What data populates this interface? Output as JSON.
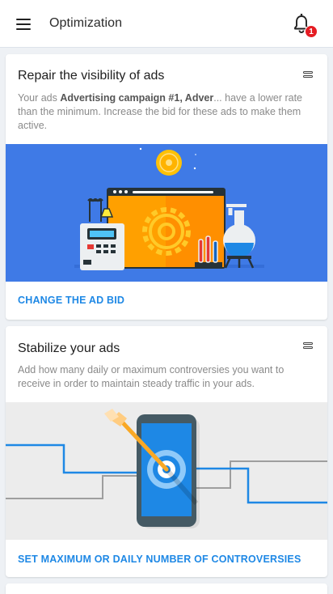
{
  "appbar": {
    "title": "Optimization",
    "notification_count": "1"
  },
  "cards": [
    {
      "title": "Repair the visibility of ads",
      "desc_prefix": "Your ads ",
      "desc_bold": "Advertising campaign #1, Adver",
      "desc_suffix": "... have a lower rate than the minimum. Increase the bid for these ads to make them active.",
      "action": "CHANGE THE AD BID"
    },
    {
      "title": "Stabilize your ads",
      "desc": "Add how many daily or maximum controversies you want to receive in order to maintain steady traffic in your ads.",
      "action": "SET MAXIMUM OR DAILY NUMBER OF CONTROVERSIES"
    }
  ],
  "colors": {
    "accent": "#1e88e5",
    "badge": "#e51c23",
    "illustration_blue": "#3f7ae6",
    "illustration_orange": "#ffa000"
  }
}
